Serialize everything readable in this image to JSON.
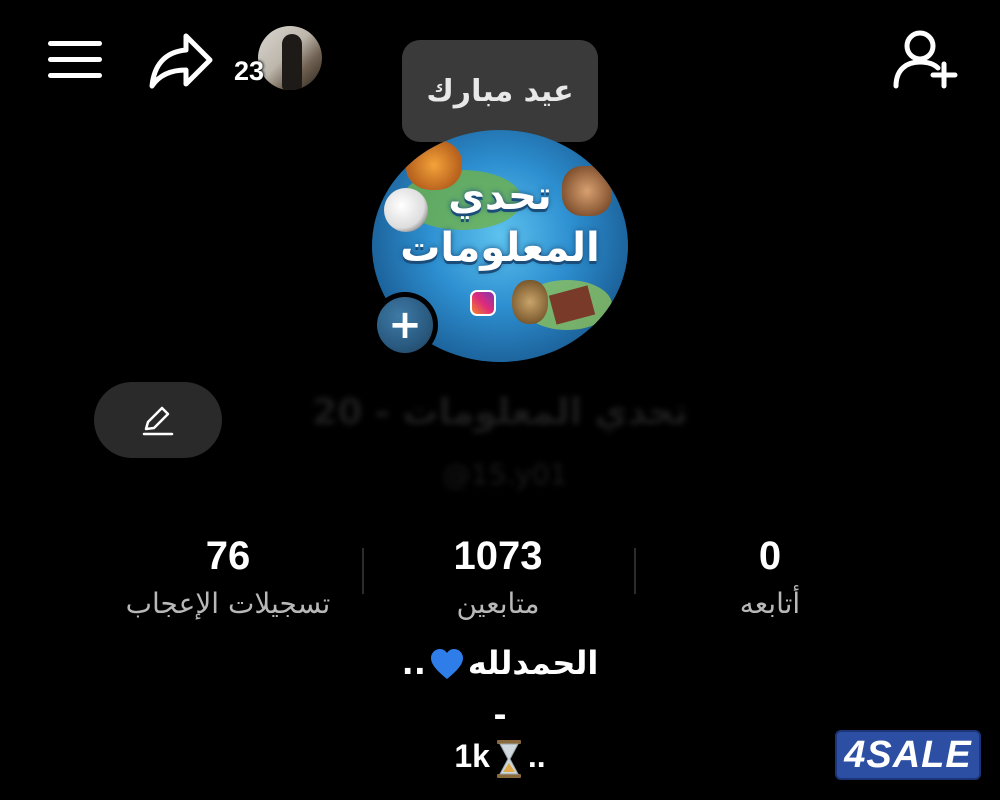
{
  "header": {
    "viewer_count": "23",
    "icons": {
      "menu": "menu-icon",
      "share": "share-icon",
      "add_user": "add-user-icon"
    }
  },
  "note": {
    "text": "عيد مبارك"
  },
  "profile": {
    "avatar_title": "تحدي المعلومات",
    "display_name": "تحدي المعلومات - 20",
    "username": "@15.y01"
  },
  "stats": [
    {
      "value": "76",
      "label": "تسجيلات الإعجاب"
    },
    {
      "value": "1073",
      "label": "متابعين"
    },
    {
      "value": "0",
      "label": "أتابعه"
    }
  ],
  "bio": {
    "line1_text": "الحمدلله",
    "line1_suffix": "..",
    "line2": "-",
    "line3_prefix": "1k",
    "line3_suffix": ".."
  },
  "watermark": {
    "text": "4SALE"
  },
  "colors": {
    "background": "#000000",
    "note_bubble": "#3a3a3a",
    "edit_button": "#2a2a2a",
    "stat_label": "#b8b8b8",
    "heart": "#2f7de8",
    "watermark_bg": "#2d4fa3"
  }
}
